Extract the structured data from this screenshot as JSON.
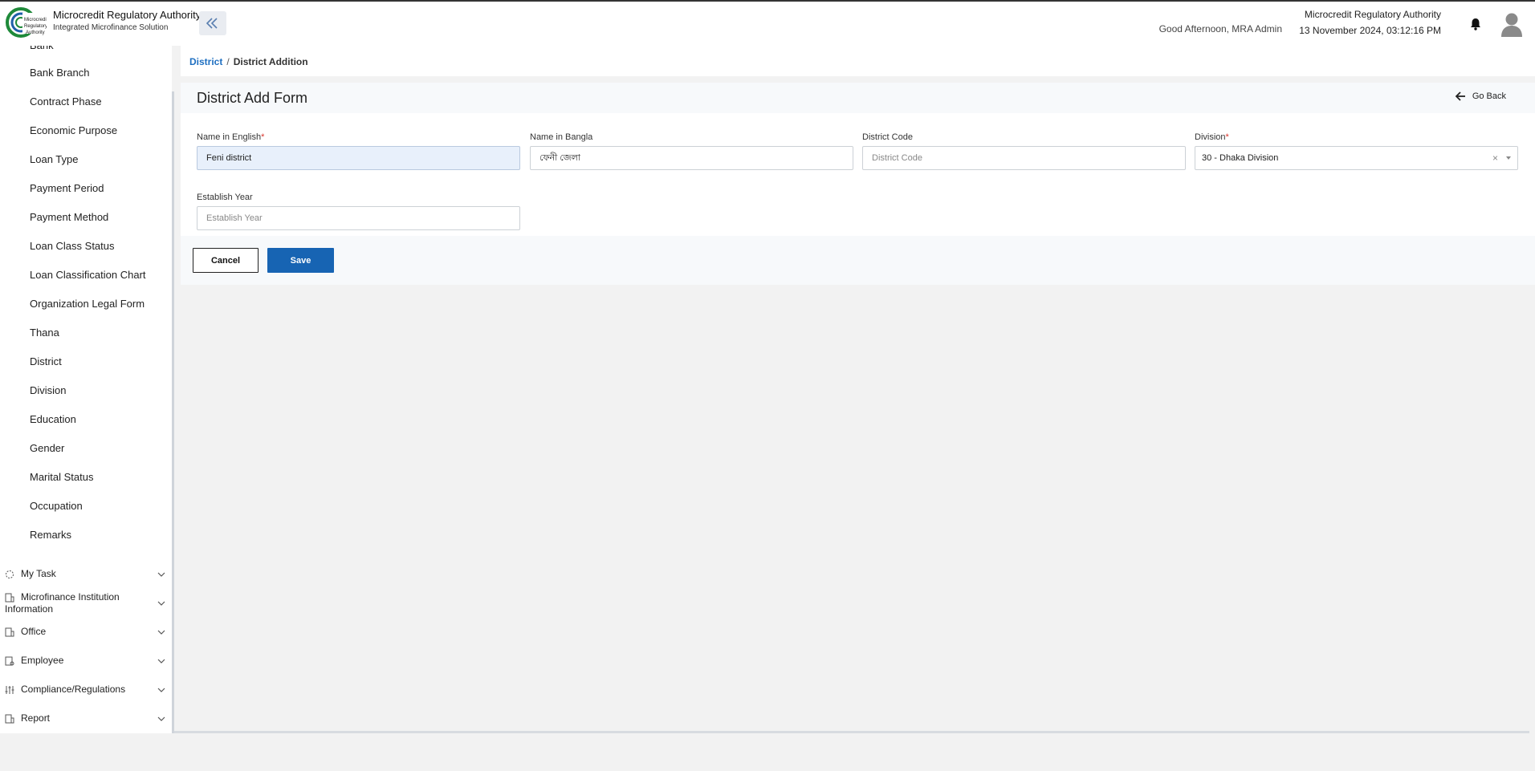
{
  "header": {
    "brand_title": "Microcredit Regulatory Authority",
    "brand_subtitle": "Integrated Microfinance Solution",
    "logo_text": "Microcredit Regulatory Authority",
    "greeting": "Good Afternoon, MRA Admin",
    "org_name": "Microcredit Regulatory Authority",
    "datetime": "13 November 2024, 03:12:16 PM"
  },
  "sidebar": {
    "partial_top_item": "Bank",
    "items": [
      "Bank Branch",
      "Contract Phase",
      "Economic Purpose",
      "Loan Type",
      "Payment Period",
      "Payment Method",
      "Loan Class Status",
      "Loan Classification Chart",
      "Organization Legal Form",
      "Thana",
      "District",
      "Division",
      "Education",
      "Gender",
      "Marital Status",
      "Occupation",
      "Remarks"
    ],
    "groups": [
      {
        "label": "My Task",
        "icon": "task-icon"
      },
      {
        "label": "Microfinance Institution",
        "label2": "Information",
        "icon": "institution-icon"
      },
      {
        "label": "Office",
        "icon": "office-icon"
      },
      {
        "label": "Employee",
        "icon": "employee-icon"
      },
      {
        "label": "Compliance/Regulations",
        "icon": "sliders-icon"
      },
      {
        "label": "Report",
        "icon": "report-icon"
      }
    ]
  },
  "breadcrumb": {
    "parent": "District",
    "separator": "/",
    "current": "District Addition"
  },
  "form": {
    "title": "District Add Form",
    "go_back": "Go Back",
    "name_english": {
      "label": "Name in English",
      "required": "*",
      "value": "Feni district"
    },
    "name_bangla": {
      "label": "Name in Bangla",
      "value": "ফেনী জেলা"
    },
    "district_code": {
      "label": "District Code",
      "placeholder": "District Code"
    },
    "division": {
      "label": "Division",
      "required": "*",
      "value": "30 - Dhaka Division",
      "clear": "×"
    },
    "establish_year": {
      "label": "Establish Year",
      "placeholder": "Establish Year"
    }
  },
  "actions": {
    "cancel": "Cancel",
    "save": "Save"
  },
  "colors": {
    "primary": "#1764b3",
    "link": "#1e6fc1",
    "required": "#d9342b",
    "logo_green": "#1f8a3a"
  }
}
